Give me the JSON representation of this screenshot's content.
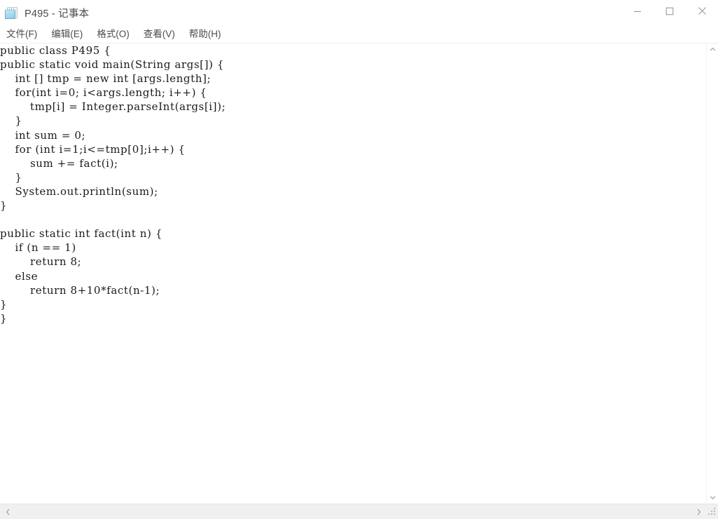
{
  "window": {
    "title": "P495 - 记事本",
    "icon": "notepad-icon",
    "controls": {
      "minimize_label": "最小化",
      "maximize_label": "最大化",
      "close_label": "关闭"
    }
  },
  "menubar": {
    "items": [
      {
        "label": "文件(F)",
        "name": "menu-file"
      },
      {
        "label": "编辑(E)",
        "name": "menu-edit"
      },
      {
        "label": "格式(O)",
        "name": "menu-format"
      },
      {
        "label": "查看(V)",
        "name": "menu-view"
      },
      {
        "label": "帮助(H)",
        "name": "menu-help"
      }
    ]
  },
  "editor": {
    "content": "public class P495 {\npublic static void main(String args[]) {\n    int [] tmp = new int [args.length];\n    for(int i=0; i<args.length; i++) {\n        tmp[i] = Integer.parseInt(args[i]);\n    }\n    int sum = 0;\n    for (int i=1;i<=tmp[0];i++) {\n        sum += fact(i);\n    }\n    System.out.println(sum);\n}\n\npublic static int fact(int n) {\n    if (n == 1)\n        return 8;\n    else\n        return 8+10*fact(n-1);\n}\n}",
    "lines": [
      "public class P495 {",
      "public static void main(String args[]) {",
      "    int [] tmp = new int [args.length];",
      "    for(int i=0; i<args.length; i++) {",
      "        tmp[i] = Integer.parseInt(args[i]);",
      "    }",
      "    int sum = 0;",
      "    for (int i=1;i<=tmp[0];i++) {",
      "        sum += fact(i);",
      "    }",
      "    System.out.println(sum);",
      "}",
      "",
      "public static int fact(int n) {",
      "    if (n == 1)",
      "        return 8;",
      "    else",
      "        return 8+10*fact(n-1);",
      "}",
      "}"
    ]
  },
  "scrollbars": {
    "vertical": {
      "up_arrow": "chevron-up-icon",
      "down_arrow": "chevron-down-icon"
    },
    "horizontal": {
      "left_arrow": "chevron-left-icon",
      "right_arrow": "chevron-right-icon"
    },
    "resize_grip": "resize-grip-icon"
  },
  "colors": {
    "window_bg": "#ffffff",
    "text": "#1a1a1a",
    "title_text": "#4a4a4a",
    "menu_text": "#4d4d4d",
    "scrollbar_track": "#f0f0f0",
    "icon_accent": "#a9dcef"
  }
}
